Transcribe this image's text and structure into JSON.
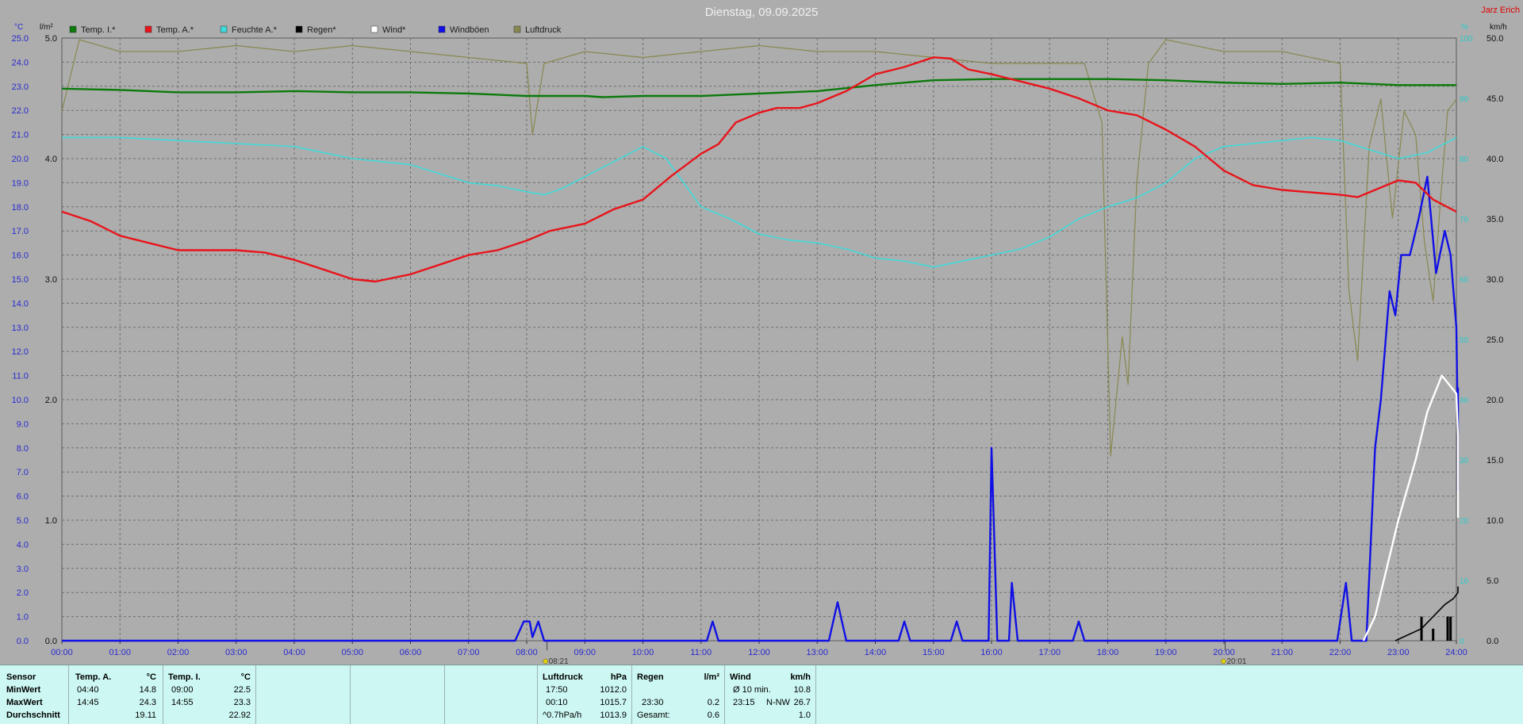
{
  "title": "Dienstag, 09.09.2025",
  "station_label": "Jarz Erich",
  "colors": {
    "temp_inside": "#0b7a0b",
    "temp_outside": "#e8141b",
    "humidity": "#40d9d9",
    "rain": "#000000",
    "wind": "#ffffff",
    "gusts": "#1010e6",
    "pressure": "#888850",
    "left_axis_text": "#2a2ad0",
    "right_axis_text": "#2bcaca",
    "title_text": "#f0f0f0"
  },
  "legend": [
    {
      "label": "Temp. I.*",
      "color": "#0b7a0b"
    },
    {
      "label": "Temp. A.*",
      "color": "#e8141b"
    },
    {
      "label": "Feuchte A.*",
      "color": "#40d9d9"
    },
    {
      "label": "Regen*",
      "color": "#000000"
    },
    {
      "label": "Wind*",
      "color": "#ffffff"
    },
    {
      "label": "Windböen",
      "color": "#1010e6"
    },
    {
      "label": "Luftdruck",
      "color": "#888850"
    }
  ],
  "chart_data": {
    "type": "line",
    "title": "Dienstag, 09.09.2025",
    "x_unit": "hours",
    "x_ticks": [
      "00:00",
      "01:00",
      "02:00",
      "03:00",
      "04:00",
      "05:00",
      "06:00",
      "07:00",
      "08:00",
      "09:00",
      "10:00",
      "11:00",
      "12:00",
      "13:00",
      "14:00",
      "15:00",
      "16:00",
      "17:00",
      "18:00",
      "19:00",
      "20:00",
      "21:00",
      "22:00",
      "23:00",
      "24:00"
    ],
    "axes": {
      "temp": {
        "unit": "°C",
        "range": [
          0,
          25
        ],
        "ticks": [
          "0.0",
          "1.0",
          "2.0",
          "3.0",
          "4.0",
          "5.0",
          "6.0",
          "7.0",
          "8.0",
          "9.0",
          "10.0",
          "11.0",
          "12.0",
          "13.0",
          "14.0",
          "15.0",
          "16.0",
          "17.0",
          "18.0",
          "19.0",
          "20.0",
          "21.0",
          "22.0",
          "23.0",
          "24.0",
          "25.0"
        ]
      },
      "rain": {
        "unit": "l/m²",
        "range": [
          0,
          5
        ],
        "ticks": [
          "0.0",
          "1.0",
          "2.0",
          "3.0",
          "4.0",
          "5.0"
        ]
      },
      "humidity": {
        "unit": "%",
        "range": [
          0,
          100
        ],
        "ticks": [
          "0",
          "10",
          "20",
          "30",
          "40",
          "50",
          "60",
          "70",
          "80",
          "90",
          "100"
        ]
      },
      "wind": {
        "unit": "km/h",
        "range": [
          0,
          50
        ],
        "ticks": [
          "0.0",
          "5.0",
          "10.0",
          "15.0",
          "20.0",
          "25.0",
          "30.0",
          "35.0",
          "40.0",
          "45.0",
          "50.0"
        ]
      }
    },
    "markers": [
      {
        "x": 8.35,
        "label": "08:21"
      },
      {
        "x": 20.02,
        "label": "20:01"
      }
    ],
    "grid": true,
    "legend_position": "top",
    "series": [
      {
        "name": "Temp. I.*",
        "axis": "temp",
        "color": "#0b7a0b",
        "points": [
          [
            0,
            22.9
          ],
          [
            1,
            22.85
          ],
          [
            2,
            22.75
          ],
          [
            3,
            22.75
          ],
          [
            4,
            22.8
          ],
          [
            5,
            22.75
          ],
          [
            6,
            22.75
          ],
          [
            7,
            22.7
          ],
          [
            8,
            22.6
          ],
          [
            9,
            22.6
          ],
          [
            9.3,
            22.55
          ],
          [
            10,
            22.6
          ],
          [
            11,
            22.6
          ],
          [
            12,
            22.7
          ],
          [
            13,
            22.8
          ],
          [
            14,
            23.05
          ],
          [
            15,
            23.25
          ],
          [
            16,
            23.3
          ],
          [
            17,
            23.3
          ],
          [
            18,
            23.3
          ],
          [
            19,
            23.25
          ],
          [
            20,
            23.15
          ],
          [
            21,
            23.1
          ],
          [
            22,
            23.15
          ],
          [
            23,
            23.05
          ],
          [
            24,
            23.05
          ]
        ]
      },
      {
        "name": "Temp. A.*",
        "axis": "temp",
        "color": "#e8141b",
        "points": [
          [
            0,
            17.8
          ],
          [
            0.5,
            17.4
          ],
          [
            1,
            16.8
          ],
          [
            1.5,
            16.5
          ],
          [
            2,
            16.2
          ],
          [
            2.5,
            16.2
          ],
          [
            3,
            16.2
          ],
          [
            3.5,
            16.1
          ],
          [
            4,
            15.8
          ],
          [
            4.5,
            15.4
          ],
          [
            5,
            15.0
          ],
          [
            5.4,
            14.9
          ],
          [
            6,
            15.2
          ],
          [
            6.5,
            15.6
          ],
          [
            7,
            16.0
          ],
          [
            7.5,
            16.2
          ],
          [
            8,
            16.6
          ],
          [
            8.4,
            17.0
          ],
          [
            9,
            17.3
          ],
          [
            9.5,
            17.9
          ],
          [
            10,
            18.3
          ],
          [
            10.5,
            19.3
          ],
          [
            11,
            20.2
          ],
          [
            11.3,
            20.6
          ],
          [
            11.6,
            21.5
          ],
          [
            12,
            21.9
          ],
          [
            12.3,
            22.1
          ],
          [
            12.7,
            22.1
          ],
          [
            13,
            22.3
          ],
          [
            13.5,
            22.8
          ],
          [
            14,
            23.5
          ],
          [
            14.5,
            23.8
          ],
          [
            14.75,
            24.0
          ],
          [
            15,
            24.2
          ],
          [
            15.3,
            24.15
          ],
          [
            15.6,
            23.7
          ],
          [
            16,
            23.5
          ],
          [
            16.5,
            23.2
          ],
          [
            17,
            22.9
          ],
          [
            17.5,
            22.5
          ],
          [
            18,
            22.0
          ],
          [
            18.5,
            21.8
          ],
          [
            19,
            21.2
          ],
          [
            19.5,
            20.5
          ],
          [
            20,
            19.5
          ],
          [
            20.5,
            18.9
          ],
          [
            21,
            18.7
          ],
          [
            21.5,
            18.6
          ],
          [
            22,
            18.5
          ],
          [
            22.3,
            18.4
          ],
          [
            22.6,
            18.7
          ],
          [
            23,
            19.1
          ],
          [
            23.3,
            19.0
          ],
          [
            23.6,
            18.3
          ],
          [
            24,
            17.8
          ]
        ]
      },
      {
        "name": "Feuchte A.*",
        "axis": "humidity",
        "color": "#40d9d9",
        "points": [
          [
            0,
            83.5
          ],
          [
            1,
            83.5
          ],
          [
            2,
            83
          ],
          [
            3,
            82.5
          ],
          [
            4,
            82
          ],
          [
            5,
            80
          ],
          [
            6,
            79
          ],
          [
            7,
            76
          ],
          [
            7.5,
            75.5
          ],
          [
            8,
            74.5
          ],
          [
            8.3,
            74
          ],
          [
            8.6,
            75
          ],
          [
            9,
            77
          ],
          [
            9.5,
            79.5
          ],
          [
            10,
            82
          ],
          [
            10.4,
            80
          ],
          [
            10.7,
            76
          ],
          [
            11,
            72
          ],
          [
            11.5,
            70
          ],
          [
            12,
            67.5
          ],
          [
            12.5,
            66.5
          ],
          [
            13,
            66
          ],
          [
            13.5,
            65
          ],
          [
            14,
            63.5
          ],
          [
            14.5,
            63
          ],
          [
            15,
            62
          ],
          [
            15.5,
            63
          ],
          [
            16,
            64
          ],
          [
            16.5,
            65
          ],
          [
            17,
            67
          ],
          [
            17.5,
            70
          ],
          [
            18,
            72
          ],
          [
            18.5,
            73.5
          ],
          [
            19,
            76
          ],
          [
            19.5,
            80
          ],
          [
            20,
            82
          ],
          [
            20.5,
            82.5
          ],
          [
            21,
            83
          ],
          [
            21.5,
            83.5
          ],
          [
            22,
            83
          ],
          [
            22.5,
            81.5
          ],
          [
            23,
            80
          ],
          [
            23.5,
            81
          ],
          [
            24,
            83.5
          ]
        ]
      },
      {
        "name": "Wind*",
        "axis": "wind",
        "color": "#ffffff",
        "points": [
          [
            22.4,
            0
          ],
          [
            22.6,
            2
          ],
          [
            22.8,
            6
          ],
          [
            23,
            10
          ],
          [
            23.3,
            15
          ],
          [
            23.5,
            19
          ],
          [
            23.75,
            22
          ],
          [
            24,
            20.5
          ],
          [
            24.3,
            17
          ],
          [
            24.6,
            13
          ],
          [
            24.8,
            10.7
          ],
          [
            25,
            11
          ],
          [
            25.1,
            10.2
          ]
        ]
      },
      {
        "name": "Windböen",
        "axis": "wind",
        "color": "#1010e6",
        "points": [
          [
            0,
            0
          ],
          [
            7.8,
            0
          ],
          [
            7.95,
            1.6
          ],
          [
            8.05,
            1.6
          ],
          [
            8.1,
            0.3
          ],
          [
            8.2,
            1.6
          ],
          [
            8.3,
            0
          ],
          [
            11.1,
            0
          ],
          [
            11.2,
            1.6
          ],
          [
            11.3,
            0
          ],
          [
            13.2,
            0
          ],
          [
            13.35,
            3.2
          ],
          [
            13.5,
            0
          ],
          [
            14.4,
            0
          ],
          [
            14.5,
            1.6
          ],
          [
            14.6,
            0
          ],
          [
            15.3,
            0
          ],
          [
            15.4,
            1.6
          ],
          [
            15.5,
            0
          ],
          [
            15.95,
            0
          ],
          [
            16.0,
            16
          ],
          [
            16.1,
            0
          ],
          [
            16.3,
            0
          ],
          [
            16.35,
            4.8
          ],
          [
            16.45,
            0
          ],
          [
            17.4,
            0
          ],
          [
            17.5,
            1.6
          ],
          [
            17.6,
            0
          ],
          [
            21.95,
            0
          ],
          [
            22.1,
            4.8
          ],
          [
            22.2,
            0
          ],
          [
            22.45,
            0
          ],
          [
            22.6,
            16
          ],
          [
            22.7,
            20
          ],
          [
            22.85,
            29
          ],
          [
            22.95,
            27
          ],
          [
            23.05,
            32
          ],
          [
            23.2,
            32
          ],
          [
            23.35,
            35
          ],
          [
            23.5,
            38.5
          ],
          [
            23.65,
            30.5
          ],
          [
            23.8,
            34
          ],
          [
            23.9,
            32
          ],
          [
            24,
            26
          ],
          [
            24.2,
            17
          ],
          [
            24.4,
            12.5
          ],
          [
            24.6,
            19
          ],
          [
            24.75,
            19
          ],
          [
            24.8,
            21
          ]
        ]
      },
      {
        "name": "Luftdruck",
        "axis": "pressure",
        "color": "#888850",
        "note_axis": "plotted near top band",
        "points": [
          [
            0,
            1015.1
          ],
          [
            0.3,
            1015.7
          ],
          [
            1,
            1015.6
          ],
          [
            2,
            1015.6
          ],
          [
            3,
            1015.65
          ],
          [
            4,
            1015.6
          ],
          [
            5,
            1015.65
          ],
          [
            6,
            1015.6
          ],
          [
            7,
            1015.55
          ],
          [
            8,
            1015.5
          ],
          [
            8.1,
            1014.9
          ],
          [
            8.3,
            1015.5
          ],
          [
            9,
            1015.6
          ],
          [
            10,
            1015.55
          ],
          [
            11,
            1015.6
          ],
          [
            12,
            1015.65
          ],
          [
            13,
            1015.6
          ],
          [
            14,
            1015.6
          ],
          [
            15,
            1015.55
          ],
          [
            16,
            1015.5
          ],
          [
            17,
            1015.5
          ],
          [
            17.6,
            1015.5
          ],
          [
            17.9,
            1015.0
          ],
          [
            18.05,
            1012.2
          ],
          [
            18.25,
            1013.2
          ],
          [
            18.35,
            1012.8
          ],
          [
            18.5,
            1014.5
          ],
          [
            18.7,
            1015.5
          ],
          [
            19,
            1015.7
          ],
          [
            20,
            1015.6
          ],
          [
            21,
            1015.6
          ],
          [
            22,
            1015.5
          ],
          [
            22.15,
            1013.6
          ],
          [
            22.3,
            1013.0
          ],
          [
            22.5,
            1014.8
          ],
          [
            22.7,
            1015.2
          ],
          [
            22.9,
            1014.2
          ],
          [
            23.1,
            1015.1
          ],
          [
            23.3,
            1014.9
          ],
          [
            23.45,
            1014.0
          ],
          [
            23.6,
            1013.5
          ],
          [
            23.75,
            1014.5
          ],
          [
            23.85,
            1015.1
          ],
          [
            24,
            1015.2
          ]
        ]
      },
      {
        "name": "Regen*",
        "axis": "rain",
        "color": "#000000",
        "type": "line",
        "points": [
          [
            22.95,
            0
          ],
          [
            23.4,
            0.1
          ],
          [
            23.6,
            0.2
          ],
          [
            23.8,
            0.3
          ],
          [
            23.95,
            0.35
          ],
          [
            24.05,
            0.4
          ],
          [
            24.15,
            0.45
          ]
        ]
      }
    ],
    "rain_bars": [
      {
        "x": 23.4,
        "value": 0.2
      },
      {
        "x": 23.6,
        "value": 0.1
      },
      {
        "x": 23.85,
        "value": 0.2
      },
      {
        "x": 23.9,
        "value": 0.2
      }
    ]
  },
  "stats": {
    "rows": [
      "Sensor",
      "MinWert",
      "MaxWert",
      "Durchschnitt"
    ],
    "temp_a": {
      "header": "Temp. A.",
      "unit": "°C",
      "min_time": "04:40",
      "min": "14.8",
      "max_time": "14:45",
      "max": "24.3",
      "avg": "19.11"
    },
    "temp_i": {
      "header": "Temp. I.",
      "unit": "°C",
      "min_time": "09:00",
      "min": "22.5",
      "max_time": "14:55",
      "max": "23.3",
      "avg": "22.92"
    },
    "pressure": {
      "header": "Luftdruck",
      "unit": "hPa",
      "min_time": "17:50",
      "min": "1012.0",
      "max_time": "00:10",
      "max": "1015.7",
      "trend": "^0.7hPa/h",
      "avg": "1013.9"
    },
    "rain": {
      "header": "Regen",
      "unit": "l/m²",
      "min_value": "",
      "max_time": "23:30",
      "max": "0.2",
      "total_label": "Gesamt:",
      "total": "0.6"
    },
    "wind": {
      "header": "Wind",
      "unit": "km/h",
      "avg10_label": "Ø 10 min.",
      "avg10": "10.8",
      "max_time": "23:15",
      "max_dir": "N-NW",
      "max": "26.7",
      "avg": "1.0"
    }
  }
}
